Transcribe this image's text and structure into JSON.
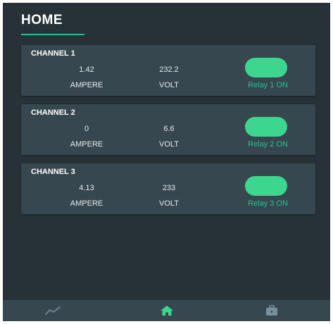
{
  "header": {
    "title": "HOME"
  },
  "channels": [
    {
      "title": "CHANNEL 1",
      "ampere": "1.42",
      "ampere_label": "AMPERE",
      "volt": "232.2",
      "volt_label": "VOLT",
      "relay_status": "Relay 1 ON"
    },
    {
      "title": "CHANNEL 2",
      "ampere": "0",
      "ampere_label": "AMPERE",
      "volt": "6.6",
      "volt_label": "VOLT",
      "relay_status": "Relay 2 ON"
    },
    {
      "title": "CHANNEL 3",
      "ampere": "4.13",
      "ampere_label": "AMPERE",
      "volt": "233",
      "volt_label": "VOLT",
      "relay_status": "Relay 3 ON"
    }
  ],
  "bottom_nav": {
    "items": [
      {
        "icon": "chart-line-icon",
        "active": false
      },
      {
        "icon": "home-icon",
        "active": true
      },
      {
        "icon": "briefcase-icon",
        "active": false
      }
    ]
  },
  "colors": {
    "background": "#263238",
    "card": "#37474f",
    "accent": "#3dd68e",
    "accent_text": "#2bbd8f",
    "inactive_icon": "#78909c"
  }
}
